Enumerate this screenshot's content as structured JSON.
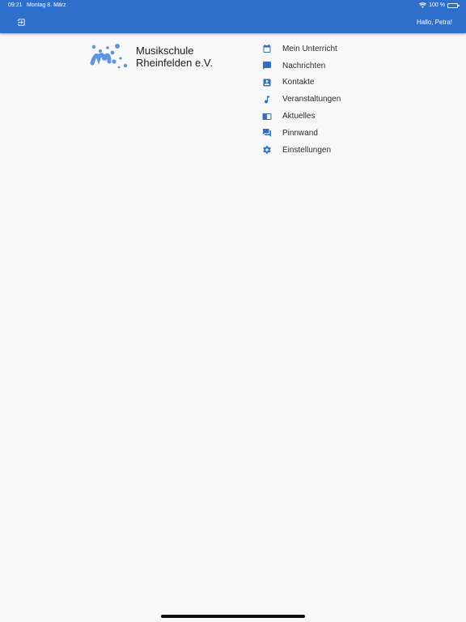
{
  "status_bar": {
    "time": "09:21",
    "date": "Montag 8. März",
    "battery": "100 %"
  },
  "header": {
    "logout_icon": "logout-icon",
    "greeting": "Hallo, Petra!"
  },
  "logo": {
    "line1": "Musikschule",
    "line2": "Rheinfelden e.V."
  },
  "menu": {
    "items": [
      {
        "label": "Mein Unterricht",
        "icon": "calendar-icon"
      },
      {
        "label": "Nachrichten",
        "icon": "chat-icon"
      },
      {
        "label": "Kontakte",
        "icon": "contact-card-icon"
      },
      {
        "label": "Veranstaltungen",
        "icon": "music-note-icon"
      },
      {
        "label": "Aktuelles",
        "icon": "news-icon"
      },
      {
        "label": "Pinnwand",
        "icon": "forum-icon"
      },
      {
        "label": "Einstellungen",
        "icon": "gear-icon"
      }
    ]
  },
  "colors": {
    "brand": "#2f6fcc",
    "icon": "#2f6fcc",
    "logo_blue": "#5b95e8"
  }
}
